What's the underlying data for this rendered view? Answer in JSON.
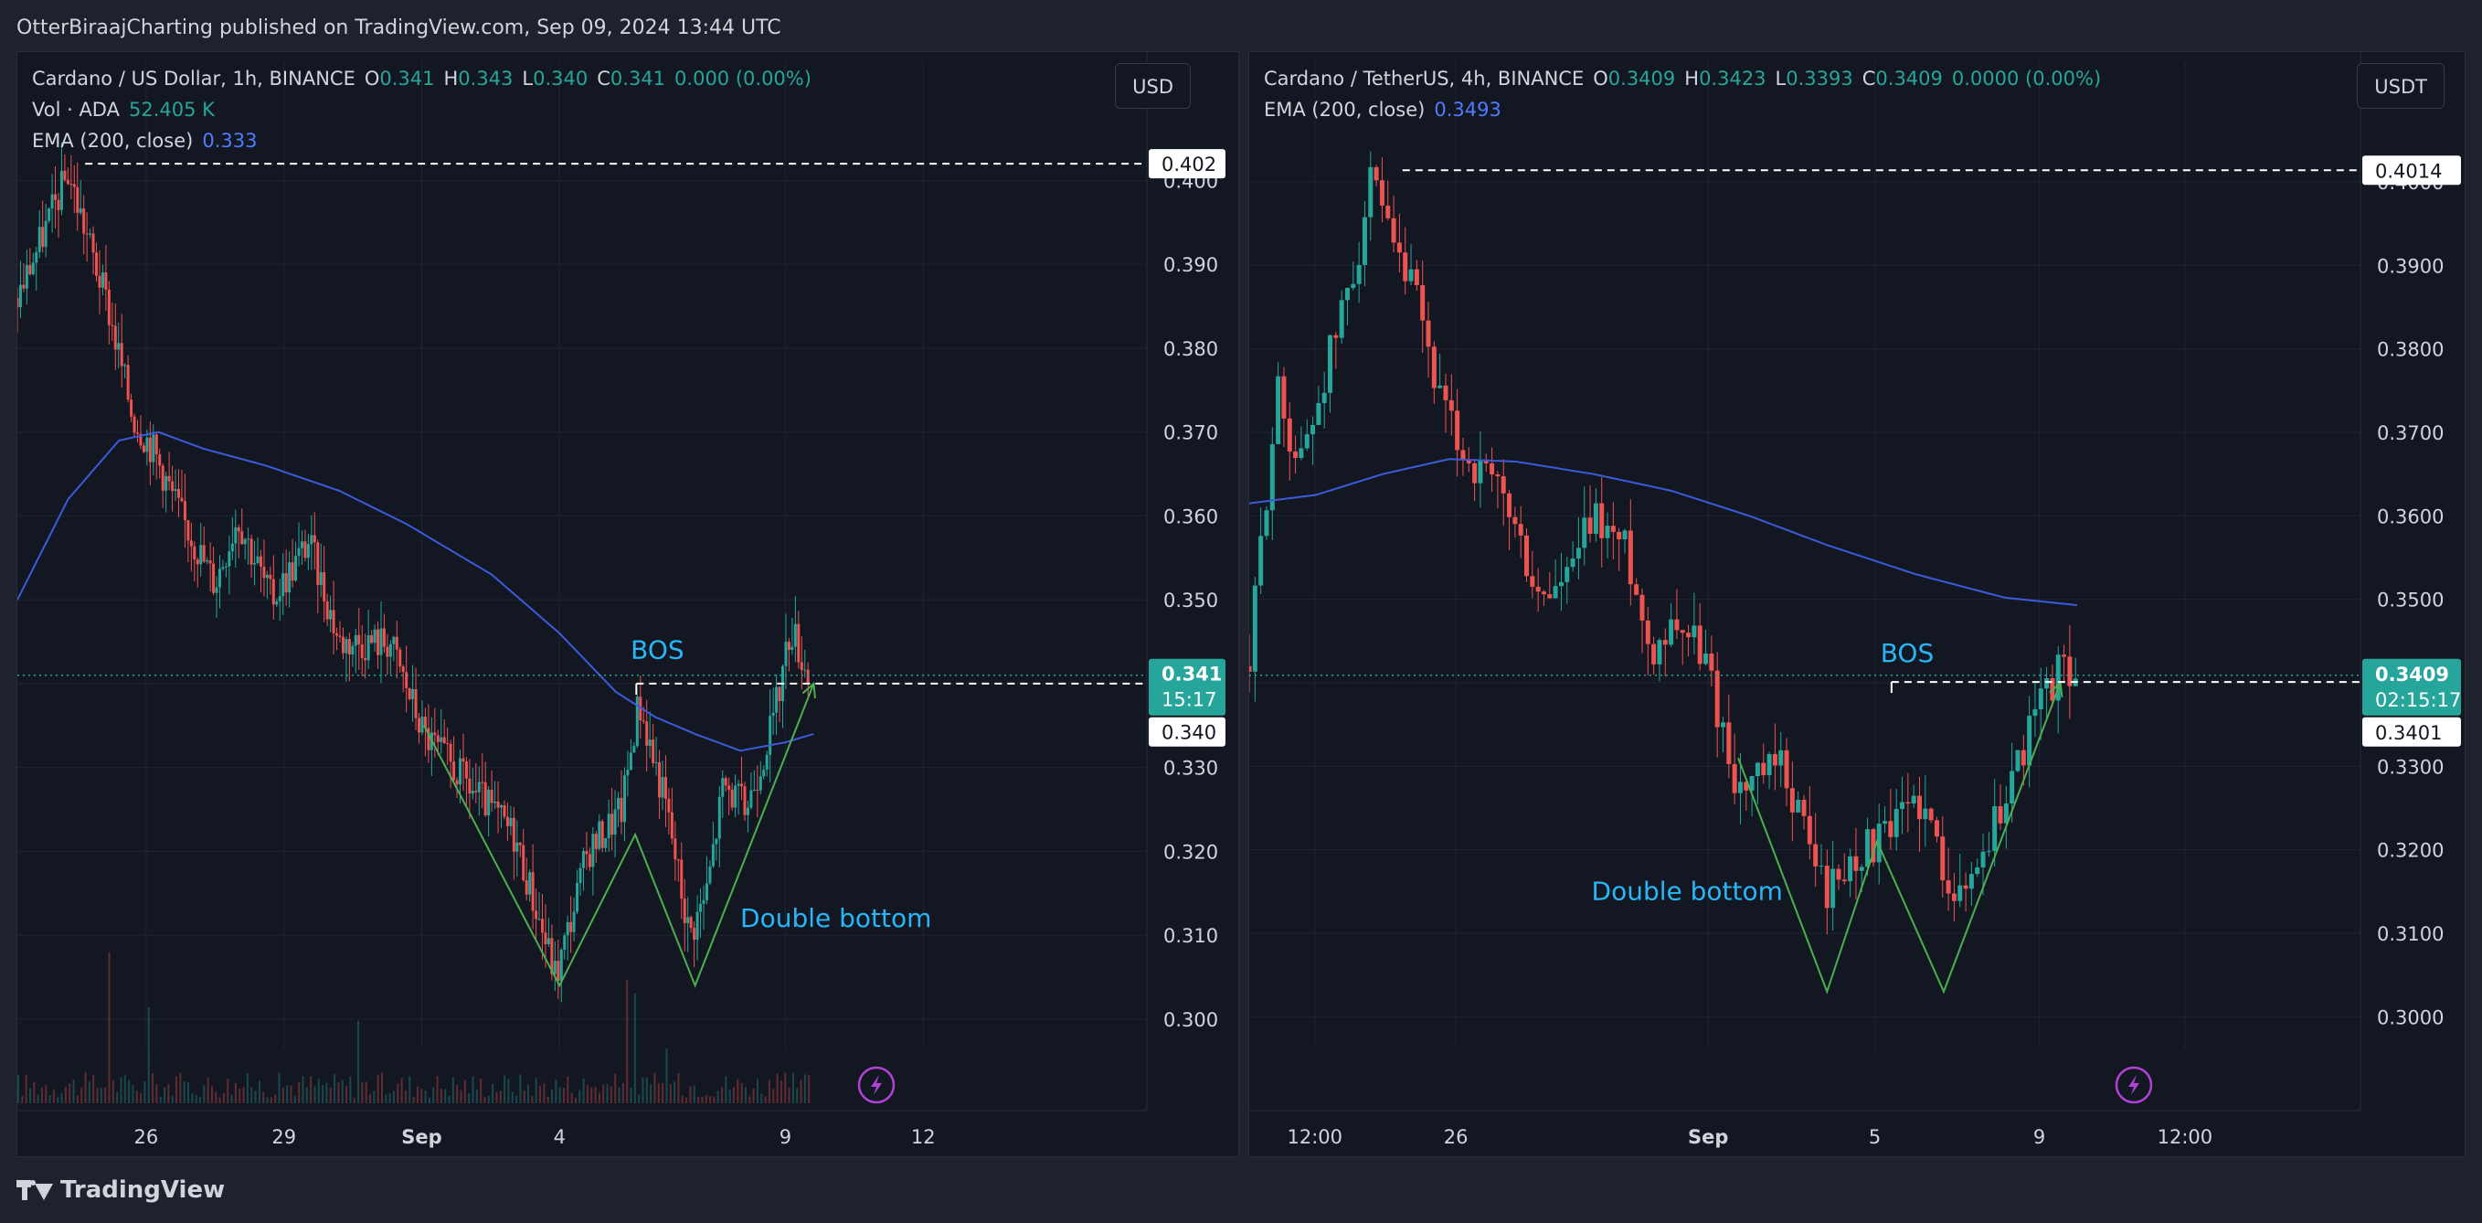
{
  "attribution": "OtterBiraajCharting published on TradingView.com, Sep 09, 2024 13:44 UTC",
  "footer": {
    "brand": "TradingView"
  },
  "colors": {
    "up": "#26a69a",
    "down": "#ef5350",
    "ema": "#3b5bdb",
    "annotation": "#4caf50",
    "text_accent": "#29b6f6",
    "bg": "#131722",
    "grid": "#1f2430"
  },
  "left": {
    "symbol": "Cardano / US Dollar, 1h, BINANCE",
    "ohlc": [
      {
        "k": "O",
        "v": "0.341"
      },
      {
        "k": "H",
        "v": "0.343"
      },
      {
        "k": "L",
        "v": "0.340"
      },
      {
        "k": "C",
        "v": "0.341"
      }
    ],
    "change": "0.000 (0.00%)",
    "vol_label": "Vol · ADA",
    "vol_value": "52.405 K",
    "ema_label": "EMA (200, close)",
    "ema_value": "0.333",
    "currency": "USD",
    "annotations": {
      "bos": "BOS",
      "pattern": "Double bottom"
    },
    "price_tags": {
      "top": "0.402",
      "last": "0.341",
      "countdown": "15:17",
      "level": "0.340"
    }
  },
  "right": {
    "symbol": "Cardano / TetherUS, 4h, BINANCE",
    "ohlc": [
      {
        "k": "O",
        "v": "0.3409"
      },
      {
        "k": "H",
        "v": "0.3423"
      },
      {
        "k": "L",
        "v": "0.3393"
      },
      {
        "k": "C",
        "v": "0.3409"
      }
    ],
    "change": "0.0000 (0.00%)",
    "ema_label": "EMA (200, close)",
    "ema_value": "0.3493",
    "currency": "USDT",
    "annotations": {
      "bos": "BOS",
      "pattern": "Double bottom"
    },
    "price_tags": {
      "top": "0.4014",
      "last": "0.3409",
      "countdown": "02:15:17",
      "level": "0.3401"
    }
  },
  "chart_data": [
    {
      "type": "candlestick",
      "title": "Cardano / US Dollar, 1h, BINANCE",
      "ylim": [
        0.2965,
        0.4055
      ],
      "y_ticks": [
        "0.300",
        "0.310",
        "0.320",
        "0.330",
        "0.340",
        "0.350",
        "0.360",
        "0.370",
        "0.380",
        "0.390",
        "0.400"
      ],
      "y_tick_values": [
        0.3,
        0.31,
        0.32,
        0.33,
        0.34,
        0.35,
        0.36,
        0.37,
        0.38,
        0.39,
        0.4
      ],
      "x_ticks": [
        "26",
        "29",
        "Sep",
        "4",
        "9",
        "12"
      ],
      "x_tick_pos": [
        0.114,
        0.236,
        0.358,
        0.48,
        0.68,
        0.802
      ],
      "price_path": [
        [
          0.0,
          0.386
        ],
        [
          0.045,
          0.401
        ],
        [
          0.08,
          0.385
        ],
        [
          0.102,
          0.372
        ],
        [
          0.12,
          0.368
        ],
        [
          0.145,
          0.36
        ],
        [
          0.175,
          0.352
        ],
        [
          0.195,
          0.36
        ],
        [
          0.225,
          0.35
        ],
        [
          0.258,
          0.357
        ],
        [
          0.285,
          0.345
        ],
        [
          0.33,
          0.345
        ],
        [
          0.36,
          0.334
        ],
        [
          0.405,
          0.327
        ],
        [
          0.44,
          0.322
        ],
        [
          0.477,
          0.305
        ],
        [
          0.505,
          0.32
        ],
        [
          0.535,
          0.325
        ],
        [
          0.55,
          0.338
        ],
        [
          0.575,
          0.325
        ],
        [
          0.595,
          0.31
        ],
        [
          0.61,
          0.315
        ],
        [
          0.625,
          0.328
        ],
        [
          0.645,
          0.325
        ],
        [
          0.67,
          0.336
        ],
        [
          0.685,
          0.347
        ],
        [
          0.7,
          0.341
        ]
      ],
      "ema_path": [
        [
          0.0,
          0.35
        ],
        [
          0.045,
          0.362
        ],
        [
          0.09,
          0.369
        ],
        [
          0.125,
          0.37
        ],
        [
          0.165,
          0.368
        ],
        [
          0.22,
          0.366
        ],
        [
          0.285,
          0.363
        ],
        [
          0.345,
          0.359
        ],
        [
          0.42,
          0.353
        ],
        [
          0.48,
          0.346
        ],
        [
          0.53,
          0.339
        ],
        [
          0.565,
          0.336
        ],
        [
          0.6,
          0.334
        ],
        [
          0.64,
          0.332
        ],
        [
          0.68,
          0.333
        ],
        [
          0.705,
          0.334
        ]
      ],
      "annotation_path": [
        [
          0.36,
          0.335
        ],
        [
          0.48,
          0.304
        ],
        [
          0.547,
          0.322
        ],
        [
          0.6,
          0.304
        ],
        [
          0.705,
          0.34
        ]
      ],
      "bos_level": 0.34,
      "bos_range": [
        0.548,
        0.7
      ],
      "high_level": 0.402,
      "high_x": 0.06,
      "last_price": 0.341,
      "bos_label_pos": [
        0.543,
        0.343
      ],
      "pattern_label_pos": [
        0.64,
        0.311
      ],
      "volume_spikes": [
        [
          0.08,
          0.55
        ],
        [
          0.115,
          0.35
        ],
        [
          0.3,
          0.3
        ],
        [
          0.54,
          0.45
        ],
        [
          0.545,
          0.4
        ],
        [
          0.575,
          0.2
        ]
      ]
    },
    {
      "type": "candlestick",
      "title": "Cardano / TetherUS, 4h, BINANCE",
      "ylim": [
        0.2962,
        0.4057
      ],
      "y_ticks": [
        "0.3000",
        "0.3100",
        "0.3200",
        "0.3300",
        "0.3400",
        "0.3500",
        "0.3600",
        "0.3700",
        "0.3800",
        "0.3900",
        "0.4000"
      ],
      "y_tick_values": [
        0.3,
        0.31,
        0.32,
        0.33,
        0.34,
        0.35,
        0.36,
        0.37,
        0.38,
        0.39,
        0.4
      ],
      "x_ticks": [
        "12:00",
        "26",
        "Sep",
        "5",
        "9",
        "12:00"
      ],
      "x_tick_pos": [
        0.059,
        0.186,
        0.413,
        0.563,
        0.711,
        0.842
      ],
      "price_path": [
        [
          0.0,
          0.342
        ],
        [
          0.01,
          0.356
        ],
        [
          0.025,
          0.375
        ],
        [
          0.045,
          0.366
        ],
        [
          0.07,
          0.378
        ],
        [
          0.095,
          0.39
        ],
        [
          0.11,
          0.4
        ],
        [
          0.13,
          0.391
        ],
        [
          0.15,
          0.386
        ],
        [
          0.175,
          0.372
        ],
        [
          0.2,
          0.366
        ],
        [
          0.23,
          0.362
        ],
        [
          0.26,
          0.35
        ],
        [
          0.285,
          0.352
        ],
        [
          0.31,
          0.36
        ],
        [
          0.34,
          0.356
        ],
        [
          0.36,
          0.344
        ],
        [
          0.385,
          0.348
        ],
        [
          0.41,
          0.343
        ],
        [
          0.44,
          0.327
        ],
        [
          0.48,
          0.33
        ],
        [
          0.52,
          0.315
        ],
        [
          0.55,
          0.32
        ],
        [
          0.58,
          0.322
        ],
        [
          0.6,
          0.327
        ],
        [
          0.62,
          0.32
        ],
        [
          0.64,
          0.314
        ],
        [
          0.67,
          0.323
        ],
        [
          0.69,
          0.33
        ],
        [
          0.71,
          0.337
        ],
        [
          0.73,
          0.342
        ],
        [
          0.745,
          0.341
        ]
      ],
      "ema_path": [
        [
          0.0,
          0.3615
        ],
        [
          0.06,
          0.3625
        ],
        [
          0.12,
          0.365
        ],
        [
          0.18,
          0.3668
        ],
        [
          0.24,
          0.3665
        ],
        [
          0.31,
          0.365
        ],
        [
          0.38,
          0.363
        ],
        [
          0.45,
          0.36
        ],
        [
          0.52,
          0.3565
        ],
        [
          0.6,
          0.353
        ],
        [
          0.68,
          0.3502
        ],
        [
          0.745,
          0.3493
        ]
      ],
      "annotation_path": [
        [
          0.44,
          0.331
        ],
        [
          0.52,
          0.303
        ],
        [
          0.565,
          0.321
        ],
        [
          0.625,
          0.303
        ],
        [
          0.73,
          0.34
        ]
      ],
      "bos_level": 0.3401,
      "bos_range": [
        0.578,
        0.72
      ],
      "high_level": 0.4014,
      "high_x": 0.138,
      "last_price": 0.3409,
      "bos_label_pos": [
        0.568,
        0.3425
      ],
      "pattern_label_pos": [
        0.308,
        0.314
      ],
      "volume_spikes": []
    }
  ]
}
